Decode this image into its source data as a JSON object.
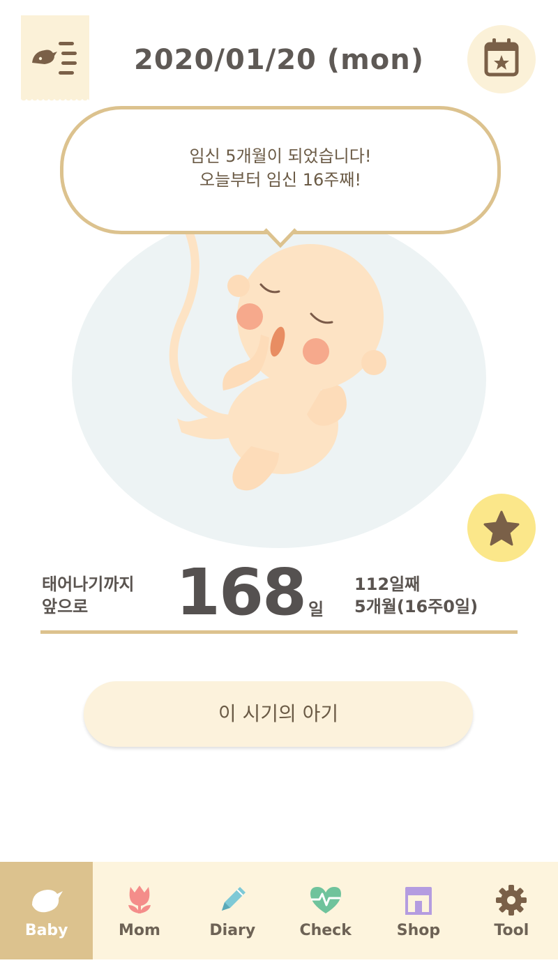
{
  "header": {
    "date": "2020/01/20 (mon)",
    "menu_icon": "bird-menu-icon",
    "calendar_icon": "calendar-star-icon"
  },
  "bubble": {
    "line1": "임신 5개월이 되었습니다!",
    "line2": "오늘부터 임신 16주째!"
  },
  "countdown": {
    "label_line1": "태어나기까지",
    "label_line2": "앞으로",
    "days": "168",
    "unit": "일",
    "stat_line1": "112일째",
    "stat_line2": "5개월(16주0일)"
  },
  "favorite_icon": "star-icon",
  "action_button": "이 시기의 아기",
  "tabs": [
    {
      "label": "Baby",
      "icon": "bird-icon",
      "active": true
    },
    {
      "label": "Mom",
      "icon": "tulip-icon",
      "active": false
    },
    {
      "label": "Diary",
      "icon": "pencil-icon",
      "active": false
    },
    {
      "label": "Check",
      "icon": "heart-pulse-icon",
      "active": false
    },
    {
      "label": "Shop",
      "icon": "shop-icon",
      "active": false
    },
    {
      "label": "Tool",
      "icon": "gear-icon",
      "active": false
    }
  ],
  "colors": {
    "accent_tan": "#dcc28e",
    "cream": "#fbf1d8",
    "star_yellow": "#fbe78a",
    "womb_blue": "#edf3f4"
  }
}
